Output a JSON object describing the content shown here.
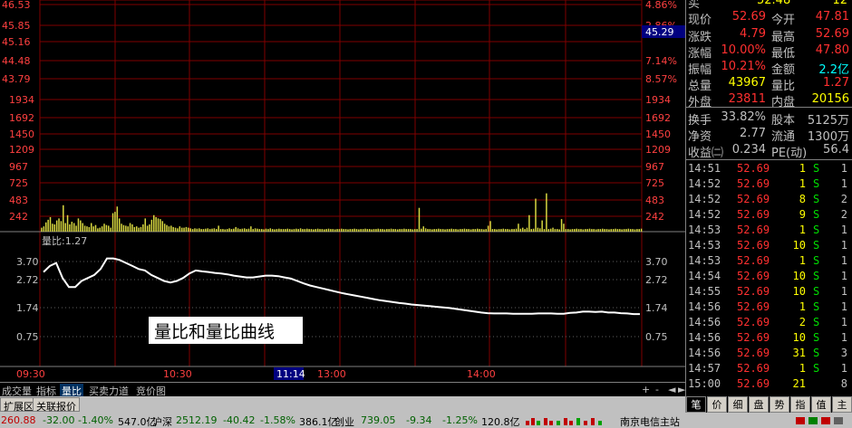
{
  "chart": {
    "price_axis_left": [
      "46.53",
      "45.85",
      "45.16",
      "44.48",
      "43.79"
    ],
    "price_axis_right": [
      "4.86%",
      "2.86%",
      "",
      "7.14%",
      "8.57%"
    ],
    "current_price_tag": "45.29",
    "volume_axis": [
      "1934",
      "1692",
      "1450",
      "1209",
      "967",
      "725",
      "483",
      "242"
    ],
    "ratio_label": "量比:1.27",
    "ratio_axis": [
      "3.70",
      "2.72",
      "1.74",
      "0.75"
    ],
    "annotation": "量比和量比曲线",
    "time_axis": [
      "09:30",
      "10:30",
      "11:14",
      "13:00",
      "14:00"
    ],
    "volume_bars": [
      60,
      80,
      140,
      180,
      220,
      120,
      110,
      170,
      200,
      160,
      400,
      130,
      250,
      110,
      150,
      130,
      90,
      200,
      170,
      130,
      90,
      80,
      70,
      130,
      80,
      100,
      50,
      60,
      80,
      120,
      100,
      90,
      60,
      280,
      300,
      380,
      200,
      120,
      100,
      90,
      80,
      130,
      110,
      70,
      80,
      60,
      70,
      110,
      200,
      90,
      110,
      180,
      250,
      220,
      200,
      190,
      160,
      120,
      100,
      80,
      90,
      70,
      60,
      50,
      80,
      60,
      60,
      70,
      60,
      50,
      40,
      50,
      45,
      50,
      40,
      40,
      45,
      50,
      40,
      45,
      50,
      40,
      90,
      40,
      40,
      35,
      40,
      50,
      40,
      45,
      70,
      50,
      40,
      45,
      50,
      40,
      45,
      80,
      40,
      50,
      45,
      40,
      40,
      35,
      45,
      40,
      50,
      40,
      35,
      40,
      45,
      40,
      40,
      40,
      45,
      40,
      35,
      40,
      45,
      40,
      50,
      40,
      40,
      45,
      40,
      40,
      35,
      40,
      45,
      40,
      40,
      35,
      40,
      45,
      40,
      40,
      35,
      40,
      40,
      45,
      40,
      40,
      35,
      40,
      40,
      45,
      40,
      35,
      40,
      40,
      45,
      40,
      40,
      35,
      40,
      40,
      45,
      40,
      40,
      35,
      40,
      40,
      45,
      40,
      40,
      35,
      40,
      40,
      45,
      40,
      40,
      40,
      35,
      40,
      40,
      360,
      45,
      80,
      50,
      40,
      40,
      35,
      40,
      40,
      45,
      40,
      40,
      35,
      40,
      40,
      45,
      40,
      40,
      35,
      40,
      40,
      45,
      40,
      40,
      35,
      40,
      40,
      45,
      40,
      40,
      35,
      40,
      90,
      160,
      40,
      40,
      35,
      40,
      40,
      45,
      40,
      40,
      35,
      40,
      40,
      45,
      120,
      45,
      60,
      40,
      60,
      250,
      40,
      45,
      500,
      60,
      50,
      170,
      40,
      580,
      40,
      45,
      60,
      40,
      40,
      35,
      190,
      120,
      40,
      40,
      35,
      40,
      40,
      45,
      40,
      40,
      35,
      40,
      40,
      45,
      40,
      40,
      35,
      40,
      40,
      45,
      40,
      40,
      35,
      40,
      40,
      45,
      40,
      40,
      35,
      40,
      40,
      45,
      40,
      40,
      35,
      40,
      40,
      45
    ],
    "ratio_curve": [
      2.9,
      3.1,
      3.2,
      2.7,
      2.4,
      2.4,
      2.6,
      2.7,
      2.8,
      3.0,
      3.35,
      3.35,
      3.3,
      3.2,
      3.1,
      3.0,
      2.95,
      2.8,
      2.7,
      2.6,
      2.55,
      2.6,
      2.7,
      2.85,
      2.95,
      2.92,
      2.9,
      2.87,
      2.85,
      2.82,
      2.78,
      2.75,
      2.72,
      2.72,
      2.75,
      2.78,
      2.78,
      2.76,
      2.72,
      2.68,
      2.6,
      2.52,
      2.45,
      2.4,
      2.35,
      2.3,
      2.25,
      2.2,
      2.16,
      2.12,
      2.08,
      2.04,
      2.0,
      1.96,
      1.93,
      1.9,
      1.87,
      1.85,
      1.82,
      1.8,
      1.78,
      1.76,
      1.74,
      1.72,
      1.7,
      1.67,
      1.64,
      1.61,
      1.58,
      1.55,
      1.53,
      1.52,
      1.52,
      1.52,
      1.51,
      1.51,
      1.51,
      1.51,
      1.52,
      1.52,
      1.52,
      1.51,
      1.51,
      1.54,
      1.55,
      1.58,
      1.58,
      1.57,
      1.58,
      1.55,
      1.55,
      1.53,
      1.52,
      1.5,
      1.5
    ]
  },
  "quote": {
    "top_left": "买",
    "top_mid": "52.48",
    "top_right": "12",
    "rows": [
      {
        "l1": "现价",
        "v1": "52.69",
        "l2": "今开",
        "v2": "47.81"
      },
      {
        "l1": "涨跌",
        "v1": "4.79",
        "l2": "最高",
        "v2": "52.69"
      },
      {
        "l1": "涨幅",
        "v1": "10.00%",
        "l2": "最低",
        "v2": "47.80"
      },
      {
        "l1": "振幅",
        "v1": "10.21%",
        "l2": "金额",
        "v2": "2.2亿"
      },
      {
        "l1": "总量",
        "v1": "43967",
        "l2": "量比",
        "v2": "1.27"
      },
      {
        "l1": "外盘",
        "v1": "23811",
        "l2": "内盘",
        "v2": "20156"
      },
      {
        "l1": "换手",
        "v1": "33.82%",
        "l2": "股本",
        "v2": "5125万"
      },
      {
        "l1": "净资",
        "v1": "2.77",
        "l2": "流通",
        "v2": "1300万"
      },
      {
        "l1": "收益㈡",
        "v1": "0.234",
        "l2": "PE(动)",
        "v2": "56.4"
      }
    ]
  },
  "ticks": [
    {
      "time": "14:51",
      "price": "52.69",
      "vol": "1",
      "side": "S",
      "n": "1"
    },
    {
      "time": "14:52",
      "price": "52.69",
      "vol": "1",
      "side": "S",
      "n": "1"
    },
    {
      "time": "14:52",
      "price": "52.69",
      "vol": "8",
      "side": "S",
      "n": "2"
    },
    {
      "time": "14:52",
      "price": "52.69",
      "vol": "9",
      "side": "S",
      "n": "2"
    },
    {
      "time": "14:53",
      "price": "52.69",
      "vol": "1",
      "side": "S",
      "n": "1"
    },
    {
      "time": "14:53",
      "price": "52.69",
      "vol": "10",
      "side": "S",
      "n": "1"
    },
    {
      "time": "14:53",
      "price": "52.69",
      "vol": "1",
      "side": "S",
      "n": "1"
    },
    {
      "time": "14:54",
      "price": "52.69",
      "vol": "10",
      "side": "S",
      "n": "1"
    },
    {
      "time": "14:55",
      "price": "52.69",
      "vol": "10",
      "side": "S",
      "n": "1"
    },
    {
      "time": "14:56",
      "price": "52.69",
      "vol": "1",
      "side": "S",
      "n": "1"
    },
    {
      "time": "14:56",
      "price": "52.69",
      "vol": "2",
      "side": "S",
      "n": "1"
    },
    {
      "time": "14:56",
      "price": "52.69",
      "vol": "10",
      "side": "S",
      "n": "1"
    },
    {
      "time": "14:56",
      "price": "52.69",
      "vol": "31",
      "side": "S",
      "n": "3"
    },
    {
      "time": "14:57",
      "price": "52.69",
      "vol": "1",
      "side": "S",
      "n": "1"
    },
    {
      "time": "15:00",
      "price": "52.69",
      "vol": "21",
      "side": "",
      "n": "8"
    }
  ],
  "tabs": [
    "成交量",
    "指标",
    "量比",
    "买卖力道",
    "竞价图"
  ],
  "tabs_active": "量比",
  "tabs2": [
    "扩展区",
    "关联报价"
  ],
  "tab_controls": [
    "+",
    "-",
    "◄",
    "►"
  ],
  "right_tabs": [
    "笔",
    "价",
    "细",
    "盘",
    "势",
    "指",
    "值",
    "主"
  ],
  "status": {
    "s1": "260.88",
    "s2": "-32.00",
    "s3": "-1.40%",
    "s4": "547.0亿",
    "s5": "沪深",
    "s6": "2512.19",
    "s7": "-40.42",
    "s8": "-1.58%",
    "s9": "386.1亿",
    "s10": "创业",
    "s11": "739.05",
    "s12": "-9.34",
    "s13": "-1.25%",
    "s14": "120.8亿",
    "station": "南京电信主站"
  },
  "colors": {
    "volume": "#d8d840",
    "grid": "#800000",
    "curve": "#ffffff",
    "price_axis": "#ff4040",
    "vol_axis": "#ff4040",
    "ratio_axis": "#c0c0c0"
  }
}
